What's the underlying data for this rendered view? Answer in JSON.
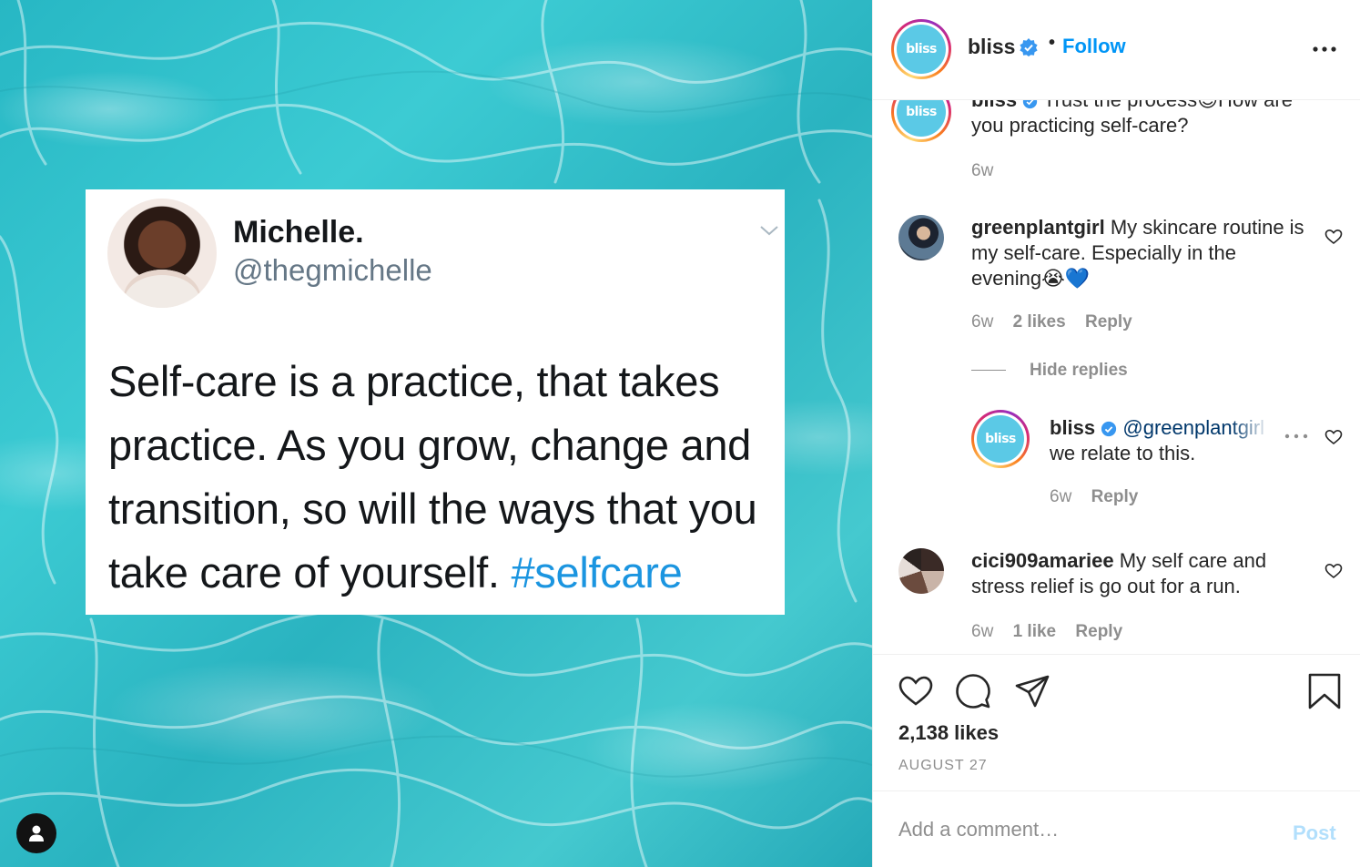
{
  "post_image": {
    "tweet": {
      "name": "Michelle.",
      "handle": "@thegmichelle",
      "text": "Self-care is a practice, that takes practice. As you grow, change and transition, so will the ways that you take care of yourself.",
      "hashtag": "#selfcare"
    },
    "user_tag_icon": "person-icon"
  },
  "header": {
    "avatar_text": "bliss",
    "username": "bliss",
    "separator": "•",
    "follow_label": "Follow",
    "more_icon": "more-horizontal-icon"
  },
  "caption": {
    "avatar_text": "bliss",
    "username": "bliss",
    "text_partial": "Trust the process😌How are",
    "text_line2": "you practicing self-care?",
    "time": "6w"
  },
  "comments": [
    {
      "username": "greenplantgirl",
      "text": "My skincare routine is my self-care. Especially in the evening😭💙",
      "time": "6w",
      "likes": "2 likes",
      "reply_label": "Reply",
      "hide_replies_label": "Hide replies",
      "replies": [
        {
          "avatar_text": "bliss",
          "username": "bliss",
          "mention": "@greenplantgirl",
          "text": "we relate to this.",
          "time": "6w",
          "reply_label": "Reply"
        }
      ]
    },
    {
      "username": "cici909amariee",
      "text": "My self care and stress relief is go out for a run.",
      "time": "6w",
      "likes": "1 like",
      "reply_label": "Reply"
    }
  ],
  "actions": {
    "likes": "2,138 likes",
    "date": "AUGUST 27"
  },
  "add_comment": {
    "placeholder": "Add a comment…",
    "post_label": "Post"
  },
  "colors": {
    "accent": "#0095f6",
    "verified": "#3897f0",
    "post_disabled": "#b2dffc",
    "logo_bg": "#5bc9e6",
    "water": "#2ab3c0"
  }
}
